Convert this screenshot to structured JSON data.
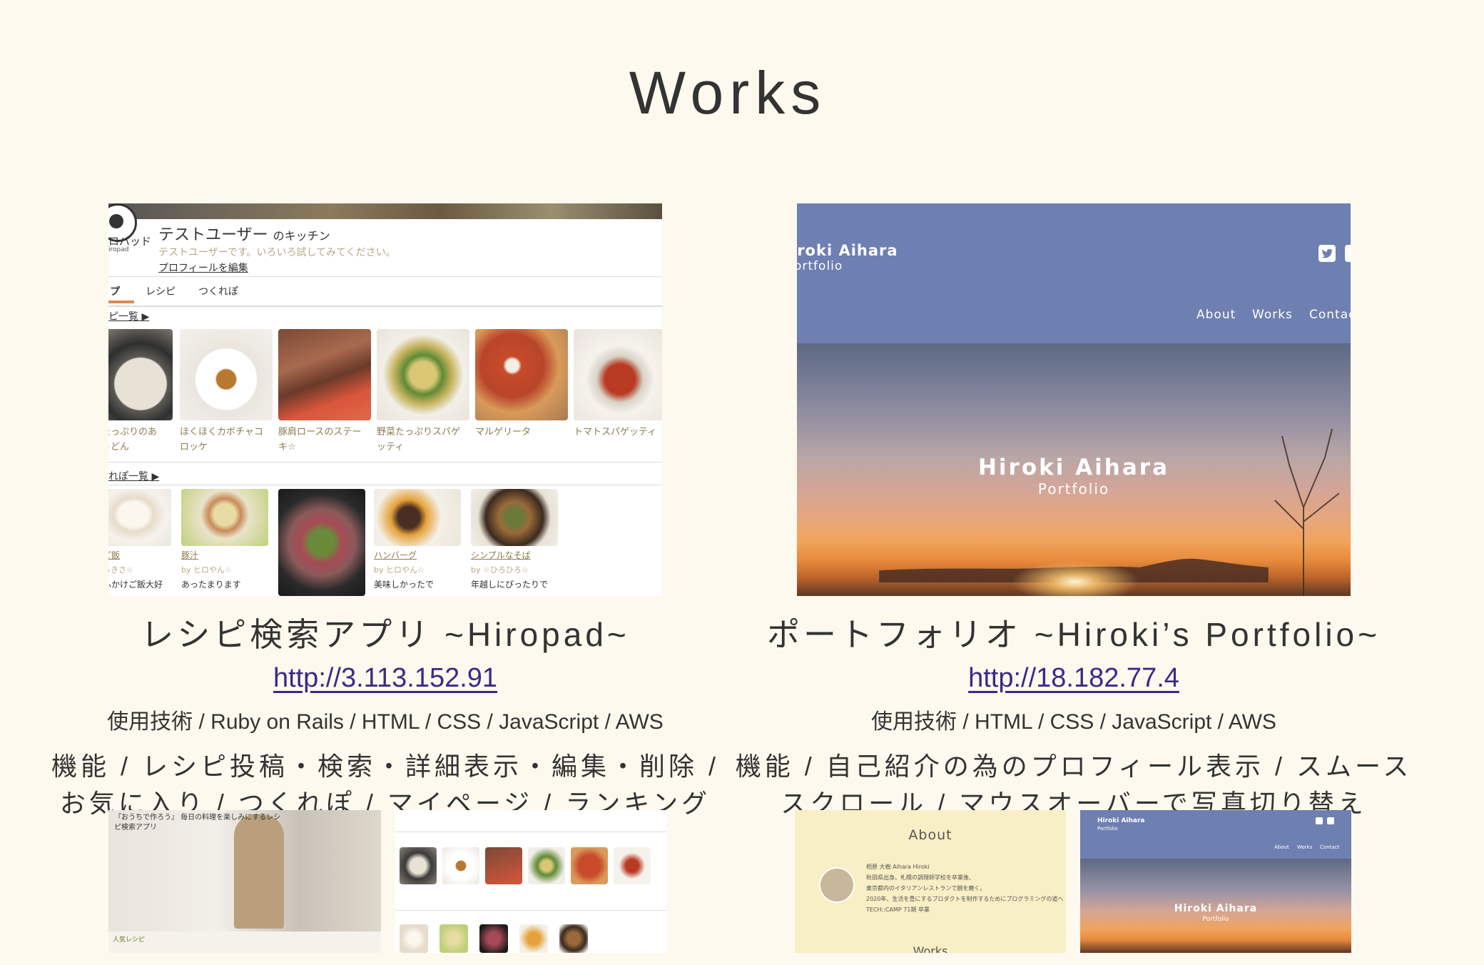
{
  "page": {
    "title": "Works"
  },
  "works": [
    {
      "title": "レシピ検索アプリ ~Hiropad~",
      "url": "http://3.113.152.91",
      "tech": "使用技術 / Ruby on Rails / HTML / CSS / JavaScript / AWS",
      "features_line1": "機能 / レシピ投稿・検索・詳細表示・編集・削除 /",
      "features_line2": "お気に入り / つくれぽ / マイページ / ランキング",
      "screenshot": {
        "logo_text": "ロパッド",
        "logo_sub": "iropad",
        "user_name": "テストユーザー",
        "kitchen_suffix": "のキッチン",
        "user_desc": "テストユーザーです。いろいろ試してみてください。",
        "edit_profile": "プロフィールを編集",
        "tabs": [
          "プ",
          "レシピ",
          "つくれぽ"
        ],
        "recipe_section": "ピ一覧 ▶",
        "recipes": [
          {
            "line1": "たっぷりのあ",
            "line2": "うどん"
          },
          {
            "line1": "ほくほくカボチャコ",
            "line2": "ロッケ"
          },
          {
            "line1": "豚肩ロースのステー",
            "line2": "キ☆"
          },
          {
            "line1": "野菜たっぷりスパゲ",
            "line2": "ッティ"
          },
          {
            "line1": "マルゲリータ",
            "line2": ""
          },
          {
            "line1": "トマトスパゲッティ",
            "line2": ""
          }
        ],
        "tsukurepo_section": "れぽ一覧 ▶",
        "tsukurepos": [
          {
            "name": "ご飯",
            "by": "ろきさ☆",
            "msg": "ふかけご飯大好"
          },
          {
            "name": "豚汁",
            "by": "by ヒロやん☆",
            "msg": "あったまります"
          },
          {
            "name": "",
            "by": "",
            "msg": ""
          },
          {
            "name": "ハンバーグ",
            "by": "by ヒロやん☆",
            "msg": "美味しかったで"
          },
          {
            "name": "シンプルなそば",
            "by": "by ☆ひろひろ☆",
            "msg": "年越しにぴったりで"
          }
        ]
      },
      "thumb1_text": "『おうちで作ろう』 毎日の料理を楽しみにするレシピ検索アプリ",
      "thumb1_footer": "人気レシピ"
    },
    {
      "title": "ポートフォリオ ~Hiroki’s Portfolio~",
      "url": "http://18.182.77.4",
      "tech": "使用技術 / HTML / CSS / JavaScript / AWS",
      "features_line1": "機能 / 自己紹介の為のプロフィール表示 / スムース",
      "features_line2": "スクロール / マウスオーバーで写真切り替え",
      "screenshot": {
        "brand": "iroki Aihara",
        "brand_sub": "ortfolio",
        "nav": [
          "About",
          "Works",
          "Contac"
        ],
        "hero_title": "Hiroki Aihara",
        "hero_sub": "Portfolio"
      },
      "thumb_about": {
        "title": "About",
        "line1": "相原 大樹 Aihara Hiroki",
        "line2": "秋田県出身。札幌の調理師学校を卒業後、",
        "line3": "東京都内のイタリアンレストランで腕を磨く。",
        "line4": "2020年、生活を豊にするプロダクトを制作するためにプログラミングの道へ",
        "line5": "TECH::CAMP 71期 卒業",
        "works": "Works"
      },
      "thumb_hero": {
        "brand": "Hiroki Aihara",
        "brand_sub": "Portfolio",
        "nav": [
          "About",
          "Works",
          "Contact"
        ],
        "title": "Hiroki Aihara",
        "sub": "Portfolio"
      }
    }
  ],
  "colors": {
    "background": "#fdf9ee",
    "link": "#3a2a86",
    "portfolio_header": "#6e7fb2"
  }
}
